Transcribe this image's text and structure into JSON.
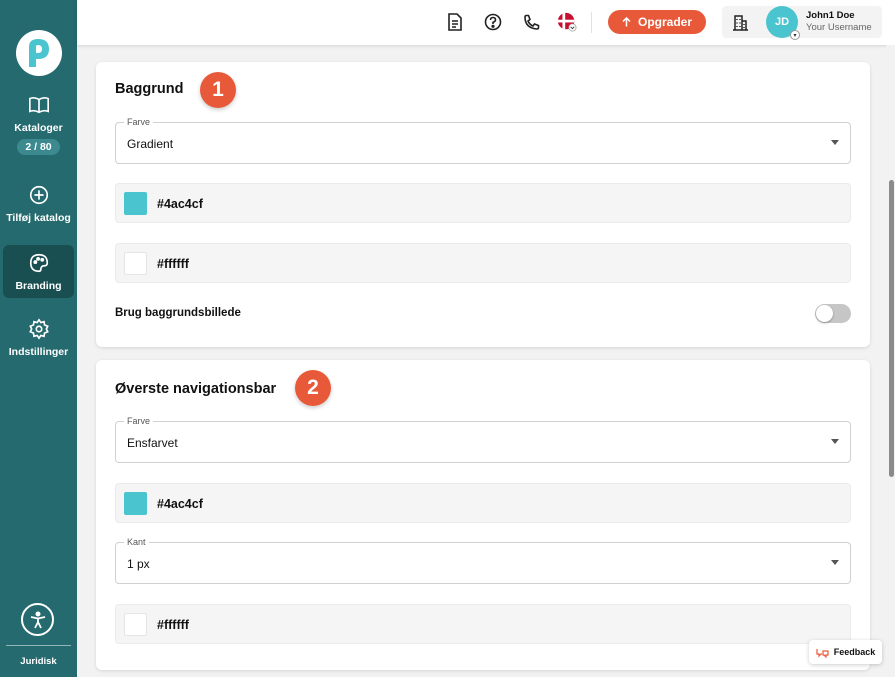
{
  "sidebar": {
    "items": [
      {
        "label": "Kataloger",
        "badge": "2 / 80",
        "icon": "book-open-icon"
      },
      {
        "label": "Tilføj katalog",
        "icon": "plus-circle-icon"
      },
      {
        "label": "Branding",
        "icon": "palette-icon",
        "active": true
      },
      {
        "label": "Indstillinger",
        "icon": "gear-icon"
      }
    ],
    "footer_label": "Juridisk"
  },
  "topbar": {
    "upgrade_label": "Opgrader",
    "user": {
      "initials": "JD",
      "name": "John1 Doe",
      "username": "Your Username"
    }
  },
  "sections": [
    {
      "title": "Baggrund",
      "step": "1",
      "fill_select": {
        "legend": "Farve",
        "value": "Gradient"
      },
      "colors": [
        "#4ac4cf",
        "#ffffff"
      ],
      "toggle": {
        "label": "Brug baggrundsbillede",
        "on": false
      }
    },
    {
      "title": "Øverste navigationsbar",
      "step": "2",
      "fill_select": {
        "legend": "Farve",
        "value": "Ensfarvet"
      },
      "color": "#4ac4cf",
      "border_select": {
        "legend": "Kant",
        "value": "1 px"
      },
      "border_color": "#ffffff"
    }
  ],
  "feedback_label": "Feedback",
  "theme": {
    "sidebar": "#256a6f",
    "accent": "#e8593a",
    "brand": "#4ac4cf"
  }
}
